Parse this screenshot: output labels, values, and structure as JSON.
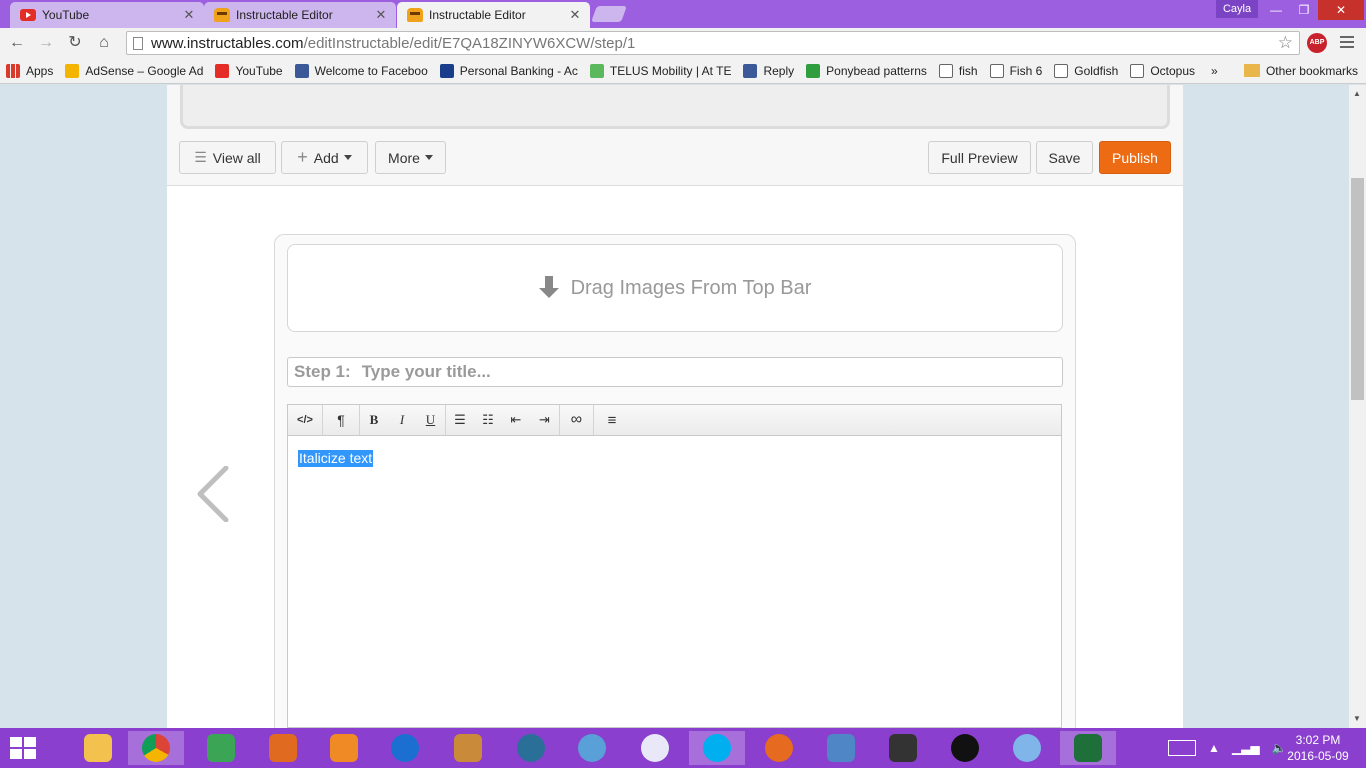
{
  "browser": {
    "tabs": [
      {
        "label": "YouTube",
        "icon": "youtube-icon"
      },
      {
        "label": "Instructable Editor",
        "icon": "instructables-robot-icon"
      },
      {
        "label": "Instructable Editor",
        "icon": "instructables-robot-icon"
      }
    ],
    "profile_name": "Cayla",
    "url_host": "www.instructables.com",
    "url_path": "/editInstructable/edit/E7QA18ZINYW6XCW/step/1",
    "abp_label": "ABP",
    "bookmarks": [
      {
        "label": "Apps",
        "icon": "apps-grid-icon"
      },
      {
        "label": "AdSense – Google Ad",
        "icon": "adsense-icon"
      },
      {
        "label": "YouTube",
        "icon": "youtube-icon"
      },
      {
        "label": "Welcome to Faceboo",
        "icon": "facebook-icon"
      },
      {
        "label": "Personal Banking - Ac",
        "icon": "bank-icon"
      },
      {
        "label": "TELUS Mobility | At TE",
        "icon": "telus-icon"
      },
      {
        "label": "Reply",
        "icon": "facebook-icon"
      },
      {
        "label": "Ponybead patterns",
        "icon": "ponybead-icon"
      },
      {
        "label": "fish",
        "icon": "page-icon"
      },
      {
        "label": "Fish 6",
        "icon": "page-icon"
      },
      {
        "label": "Goldfish",
        "icon": "page-icon"
      },
      {
        "label": "Octopus",
        "icon": "page-icon"
      }
    ],
    "bookmarks_overflow": "»",
    "other_bookmarks": "Other bookmarks"
  },
  "editor": {
    "view_all": "View all",
    "add": "Add",
    "more": "More",
    "full_preview": "Full Preview",
    "save": "Save",
    "publish": "Publish",
    "drop_zone_text": "Drag Images From Top Bar",
    "step_prefix": "Step 1:",
    "title_placeholder": "Type your title...",
    "toolbar_buttons": [
      {
        "label": "</>",
        "name": "html-source-button"
      },
      {
        "label": "¶",
        "name": "paragraph-format-button"
      },
      {
        "label": "B",
        "name": "bold-button"
      },
      {
        "label": "I",
        "name": "italic-button"
      },
      {
        "label": "U",
        "name": "underline-button"
      },
      {
        "label": "☰",
        "name": "bullet-list-button"
      },
      {
        "label": "☷",
        "name": "numbered-list-button"
      },
      {
        "label": "⇤",
        "name": "outdent-button"
      },
      {
        "label": "⇥",
        "name": "indent-button"
      },
      {
        "label": "∞",
        "name": "link-button"
      },
      {
        "label": "≡",
        "name": "align-button"
      }
    ],
    "body_text": "Italicize text"
  },
  "taskbar": {
    "time": "3:02 PM",
    "date": "2016-05-09"
  },
  "colors": {
    "accent_publish": "#ed6b13",
    "taskbar": "#8a3fce",
    "selection": "#3297fd"
  }
}
